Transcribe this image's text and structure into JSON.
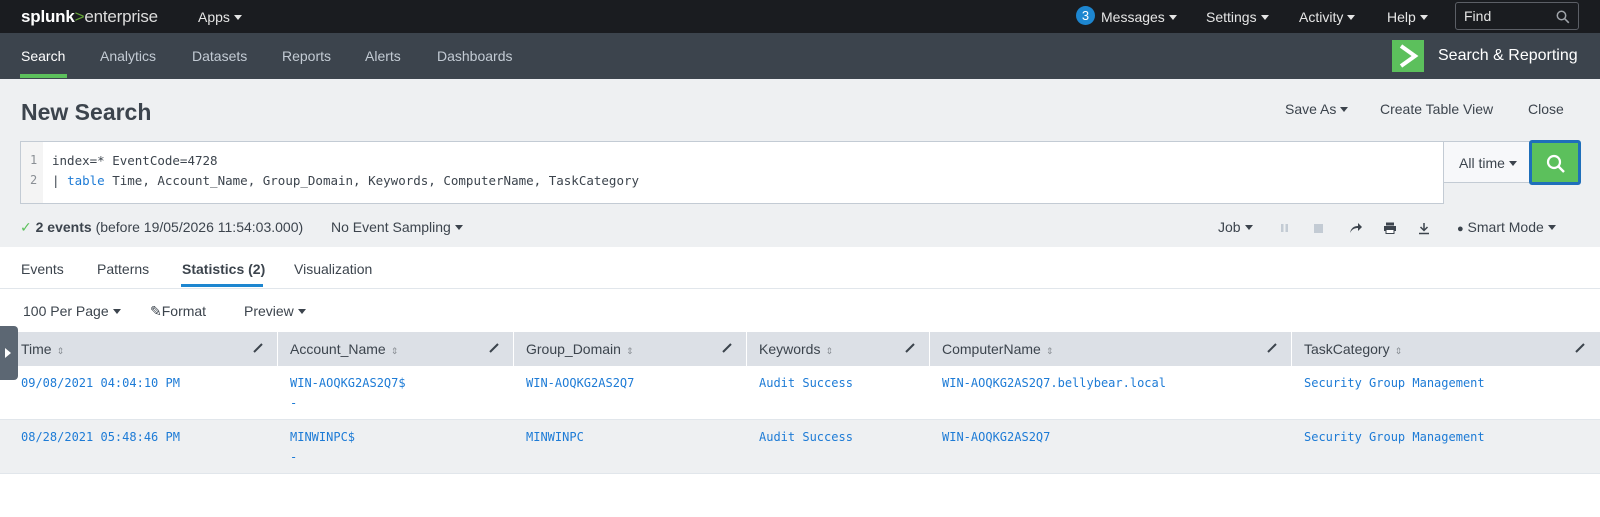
{
  "topbar": {
    "logo_part1": "splunk",
    "logo_part2": ">",
    "logo_part3": "enterprise",
    "apps_label": "Apps",
    "messages_count": "3",
    "messages_label": "Messages",
    "settings_label": "Settings",
    "activity_label": "Activity",
    "help_label": "Help",
    "find_placeholder": "Find"
  },
  "appbar": {
    "tabs": [
      "Search",
      "Analytics",
      "Datasets",
      "Reports",
      "Alerts",
      "Dashboards"
    ],
    "active_tab": "Search",
    "app_title": "Search & Reporting"
  },
  "page": {
    "title": "New Search",
    "save_as": "Save As",
    "create_table_view": "Create Table View",
    "close": "Close"
  },
  "search": {
    "line1_num": "1",
    "line1": "index=* EventCode=4728",
    "line2_num": "2",
    "line2_pipe": "| ",
    "line2_cmd": "table",
    "line2_rest": " Time, Account_Name, Group_Domain, Keywords, ComputerName, TaskCategory",
    "time_range": "All time"
  },
  "status": {
    "event_count": "2 events",
    "before_text": "(before 19/05/2026 11:54:03.000)",
    "sampling": "No Event Sampling",
    "job_label": "Job",
    "mode_label": "Smart Mode"
  },
  "result_tabs": [
    "Events",
    "Patterns",
    "Statistics (2)",
    "Visualization"
  ],
  "table_controls": {
    "per_page": "100 Per Page",
    "format": "Format",
    "preview": "Preview"
  },
  "table": {
    "columns": [
      "Time",
      "Account_Name",
      "Group_Domain",
      "Keywords",
      "ComputerName",
      "TaskCategory"
    ],
    "rows": [
      [
        "09/08/2021 04:04:10 PM",
        "WIN-AOQKG2AS2Q7$",
        "WIN-AOQKG2AS2Q7",
        "Audit Success",
        "WIN-AOQKG2AS2Q7.bellybear.local",
        "Security Group Management"
      ],
      [
        "08/28/2021 05:48:46 PM",
        "MINWINPC$",
        "MINWINPC",
        "Audit Success",
        "WIN-AOQKG2AS2Q7",
        "Security Group Management"
      ]
    ],
    "account_dash": "-"
  },
  "colors": {
    "topbar_bg": "#1a1c20",
    "appbar_bg": "#3c444d",
    "accent_green": "#5cc05c",
    "link_blue": "#1d7bd6"
  }
}
